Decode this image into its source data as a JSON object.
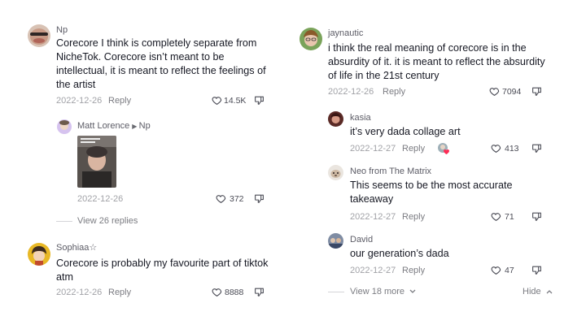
{
  "left": {
    "c1": {
      "username": "Np",
      "text": "Corecore I think is completely separate from NicheTok. Corecore isn’t meant to be intellectual, it is meant to reflect the feelings of the artist",
      "date": "2022-12-26",
      "reply": "Reply",
      "likes": "14.5K"
    },
    "r1": {
      "username": "Matt Lorence",
      "reply_to": "Np",
      "date": "2022-12-26",
      "likes": "372"
    },
    "view_replies": "View 26 replies",
    "c2": {
      "username": "Sophiaa☆",
      "text": "Corecore is probably my favourite part of tiktok atm",
      "date": "2022-12-26",
      "reply": "Reply",
      "likes": "8888"
    }
  },
  "right": {
    "c3": {
      "username": "jaynautic",
      "text": "i think the real meaning of corecore is in the absurdity of it. it is meant to reflect the absurdity of life in the 21st century",
      "date": "2022-12-26",
      "reply": "Reply",
      "likes": "7094"
    },
    "r2": {
      "username": "kasia",
      "text": "it’s very dada collage art",
      "date": "2022-12-27",
      "reply": "Reply",
      "likes": "413"
    },
    "r3": {
      "username": "Neo from The Matrix",
      "text": "This seems to be the most accurate takeaway",
      "date": "2022-12-27",
      "reply": "Reply",
      "likes": "71"
    },
    "r4": {
      "username": "David",
      "text": "our generation’s dada",
      "date": "2022-12-27",
      "reply": "Reply",
      "likes": "47"
    },
    "view_more": "View 18 more",
    "hide": "Hide"
  },
  "colors": {
    "text": "#161823",
    "meta": "#a1a2a7",
    "heart_badge": "#fe2c55"
  },
  "icons": [
    "heart-icon",
    "dislike-icon",
    "play-arrow-icon"
  ]
}
